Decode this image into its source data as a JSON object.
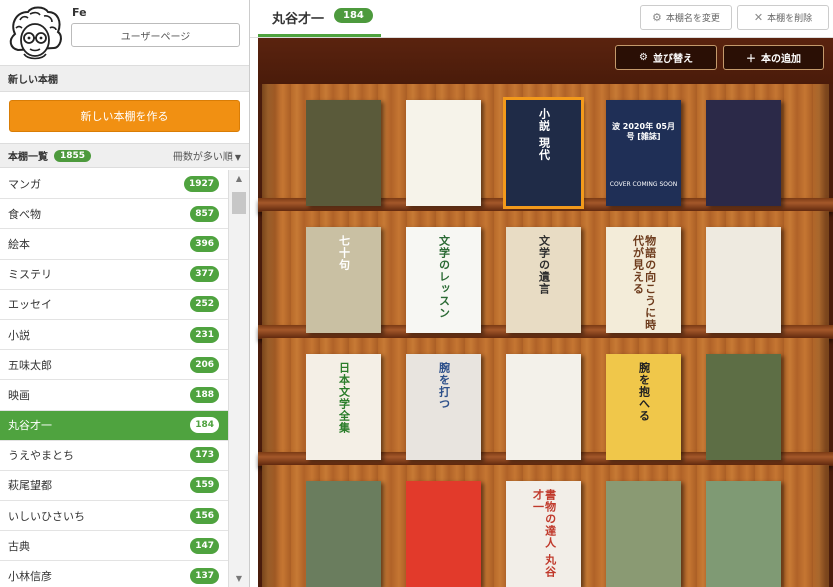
{
  "user": {
    "name": "Fe",
    "page_button": "ユーザーページ"
  },
  "sidebar": {
    "new_shelf_title": "新しい本棚",
    "new_shelf_button": "新しい本棚を作る",
    "list_title": "本棚一覧",
    "list_count": "1855",
    "sort_label": "冊数が多い順",
    "items": [
      {
        "name": "マンガ",
        "count": "1927"
      },
      {
        "name": "食べ物",
        "count": "857"
      },
      {
        "name": "絵本",
        "count": "396"
      },
      {
        "name": "ミステリ",
        "count": "377"
      },
      {
        "name": "エッセイ",
        "count": "252"
      },
      {
        "name": "小説",
        "count": "231"
      },
      {
        "name": "五味太郎",
        "count": "206"
      },
      {
        "name": "映画",
        "count": "188"
      },
      {
        "name": "丸谷才一",
        "count": "184"
      },
      {
        "name": "うえやまとち",
        "count": "173"
      },
      {
        "name": "萩尾望都",
        "count": "159"
      },
      {
        "name": "いしいひさいち",
        "count": "156"
      },
      {
        "name": "古典",
        "count": "147"
      },
      {
        "name": "小林信彦",
        "count": "137"
      }
    ],
    "active_index": 8
  },
  "main": {
    "title": "丸谷才一",
    "count": "184",
    "rename_button": "本棚名を変更",
    "delete_button": "本棚を削除",
    "sort_button": "並び替え",
    "add_button": "本の追加"
  },
  "books": [
    [
      {
        "title": "",
        "bg": "#5a5a3a",
        "fg": "#e9d9a0"
      },
      {
        "title": "",
        "bg": "#f6f3ea",
        "fg": "#333333"
      },
      {
        "title": "小説 現代",
        "bg": "#1f2b47",
        "fg": "#ffffff",
        "selected": true
      },
      {
        "title": "波 2020年 05月号 [雑誌]",
        "bg": "#1f2f56",
        "fg": "#ffffff",
        "horizontal": true,
        "note": "COVER COMING SOON"
      },
      {
        "title": "",
        "bg": "#2b2948",
        "fg": "#d6d0e8"
      }
    ],
    [
      {
        "title": "七十句",
        "bg": "#c9c0a3",
        "fg": "#ffffff"
      },
      {
        "title": "文学のレッスン",
        "bg": "#f7f7f3",
        "fg": "#2b6a34"
      },
      {
        "title": "文学の遺言",
        "bg": "#e8dcc4",
        "fg": "#2f2f2f"
      },
      {
        "title": "物語の向こうに時代が見える",
        "bg": "#f3ecd9",
        "fg": "#6d3b1c"
      },
      {
        "title": "",
        "bg": "#eeeae0",
        "fg": "#7a6a2a"
      }
    ],
    [
      {
        "title": "日本文学全集",
        "bg": "#f4efe6",
        "fg": "#2a7d2a"
      },
      {
        "title": "腕を打つ",
        "bg": "#e8e4df",
        "fg": "#2c4f8a"
      },
      {
        "title": "",
        "bg": "#f3f1ea",
        "fg": "#333333"
      },
      {
        "title": "腕を抱へる",
        "bg": "#f0c74a",
        "fg": "#222222"
      },
      {
        "title": "",
        "bg": "#5d6e45",
        "fg": "#ffffff"
      }
    ],
    [
      {
        "title": "",
        "bg": "#6a7d5e",
        "fg": "#ffffff"
      },
      {
        "title": "",
        "bg": "#e23a2b",
        "fg": "#ffffff"
      },
      {
        "title": "書物の達人 丸谷才一",
        "bg": "#f2eee8",
        "fg": "#c0392b"
      },
      {
        "title": "",
        "bg": "#8a9a73",
        "fg": "#ffffff"
      },
      {
        "title": "",
        "bg": "#7f9a74",
        "fg": "#ffffff"
      }
    ]
  ]
}
